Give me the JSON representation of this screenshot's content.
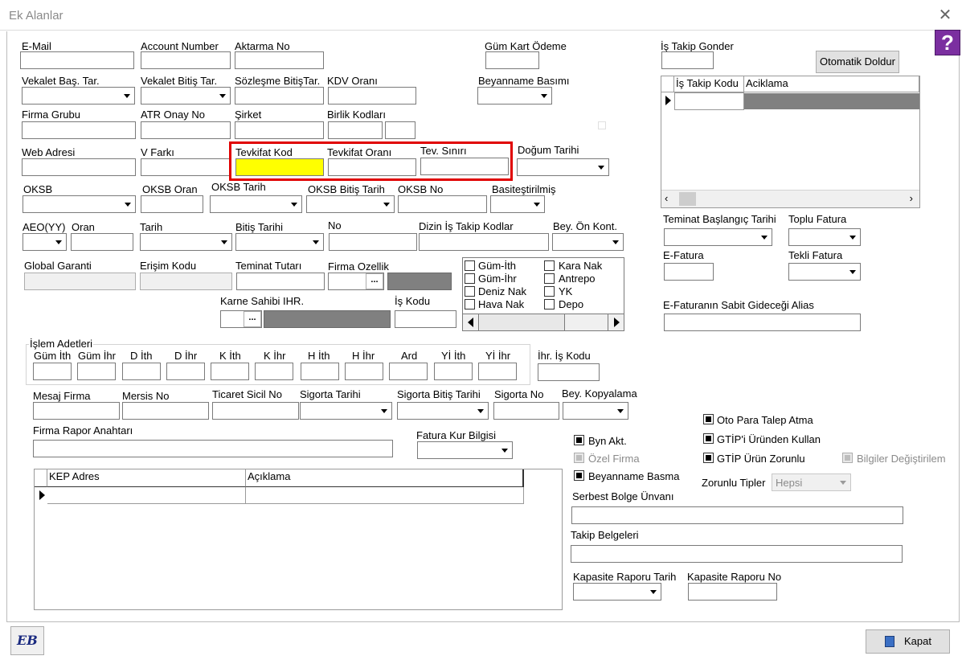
{
  "window": {
    "title": "Ek Alanlar",
    "close_glyph": "✕"
  },
  "help_glyph": "?",
  "row1": {
    "email": "E-Mail",
    "account_number": "Account Number",
    "aktarma_no": "Aktarma No",
    "gum_kart_odeme": "Güm Kart Ödeme",
    "is_takip_gonder": "İş Takip Gonder",
    "otomatik_doldur": "Otomatik Doldur"
  },
  "row2": {
    "vekalet_bas": "Vekalet Baş. Tar.",
    "vekalet_bitis": "Vekalet Bitiş Tar.",
    "sozlesme_bitis": "Sözleşme BitişTar.",
    "kdv_orani": "KDV Oranı",
    "beyanname_basimi": "Beyanname Basımı"
  },
  "is_takip_grid": {
    "col1": "İş Takip Kodu",
    "col2": "Aciklama"
  },
  "row3": {
    "firma_grubu": "Firma Grubu",
    "atr_onay_no": "ATR Onay No",
    "sirket": "Şirket",
    "birlik_kodlari": "Birlik Kodları"
  },
  "row4": {
    "web_adresi": "Web Adresi",
    "v_farki": "V Farkı",
    "tevkifat_kod": "Tevkifat Kod",
    "tevkifat_orani": "Tevkifat Oranı",
    "tev_siniri": "Tev. Sınırı",
    "dogum_tarihi": "Doğum Tarihi"
  },
  "row5": {
    "oksb": "OKSB",
    "oksb_oran": "OKSB Oran",
    "oksb_tarih": "OKSB Tarih",
    "oksb_bitis": "OKSB Bitiş Tarih",
    "oksb_no": "OKSB No",
    "basitestirilmis": "Basiteştirilmiş"
  },
  "right_mid": {
    "teminat_baslangic": "Teminat Başlangıç Tarihi",
    "toplu_fatura": "Toplu Fatura",
    "e_fatura": "E-Fatura",
    "tekli_fatura": "Tekli Fatura",
    "e_fatura_alias": "E-Faturanın Sabit Gideceği Alias"
  },
  "row6": {
    "aeo": "AEO(YY)",
    "oran": "Oran",
    "tarih": "Tarih",
    "bitis_tarihi": "Bitiş Tarihi",
    "no": "No",
    "dizin": "Dizin İş Takip Kodlar",
    "bey_on_kont": "Bey. Ön Kont."
  },
  "row7": {
    "global_garanti": "Global Garanti",
    "erisim_kodu": "Erişim Kodu",
    "teminat_tutari": "Teminat Tutarı",
    "firma_ozellik": "Firma Ozellik",
    "dots": "..."
  },
  "check_list": {
    "items_left": [
      "Güm-İth",
      "Güm-İhr",
      "Deniz Nak",
      "Hava Nak"
    ],
    "items_right": [
      "Kara Nak",
      "Antrepo",
      "YK",
      "Depo"
    ]
  },
  "row8": {
    "karne_sahibi": "Karne Sahibi IHR.",
    "is_kodu": "İş Kodu"
  },
  "islem_adetleri": {
    "title": "İşlem Adetleri",
    "cols": [
      "Güm İth",
      "Güm İhr",
      "D İth",
      "D İhr",
      "K İth",
      "K İhr",
      "H İth",
      "H İhr",
      "Ard",
      "Yİ İth",
      "Yİ İhr"
    ],
    "ihr_is_kodu": "İhr. İş Kodu"
  },
  "row9": {
    "mesaj_firma": "Mesaj Firma",
    "mersis_no": "Mersis No",
    "ticaret_sicil": "Ticaret Sicil No",
    "sigorta_tarihi": "Sigorta Tarihi",
    "sigorta_bitis": "Sigorta Bitiş Tarihi",
    "sigorta_no": "Sigorta No",
    "bey_kopyalama": "Bey. Kopyalama"
  },
  "row10": {
    "firma_rapor": "Firma Rapor Anahtarı",
    "fatura_kur": "Fatura Kur Bilgisi"
  },
  "kep_grid": {
    "col1": "KEP Adres",
    "col2": "Açıklama"
  },
  "options": {
    "oto_para": "Oto Para Talep Atma",
    "gtip_urun": "GTİP'i Üründen Kullan",
    "gtip_zorunlu": "GTİP Ürün Zorunlu",
    "bilgiler": "Bilgiler Değiştirilem",
    "byn_akt": "Byn Akt.",
    "ozel_firma": "Özel Firma",
    "beyanname_basma": "Beyanname Basma",
    "zorunlu_tipler": "Zorunlu Tipler",
    "zorunlu_value": "Hepsi"
  },
  "bottom_right": {
    "serbest_bolge": "Serbest Bolge Ünvanı",
    "takip_belgeleri": "Takip Belgeleri",
    "kapasite_tarih": "Kapasite Raporu Tarih",
    "kapasite_no": "Kapasite Raporu No"
  },
  "footer": {
    "kapat": "Kapat",
    "logo_text": "EB"
  }
}
